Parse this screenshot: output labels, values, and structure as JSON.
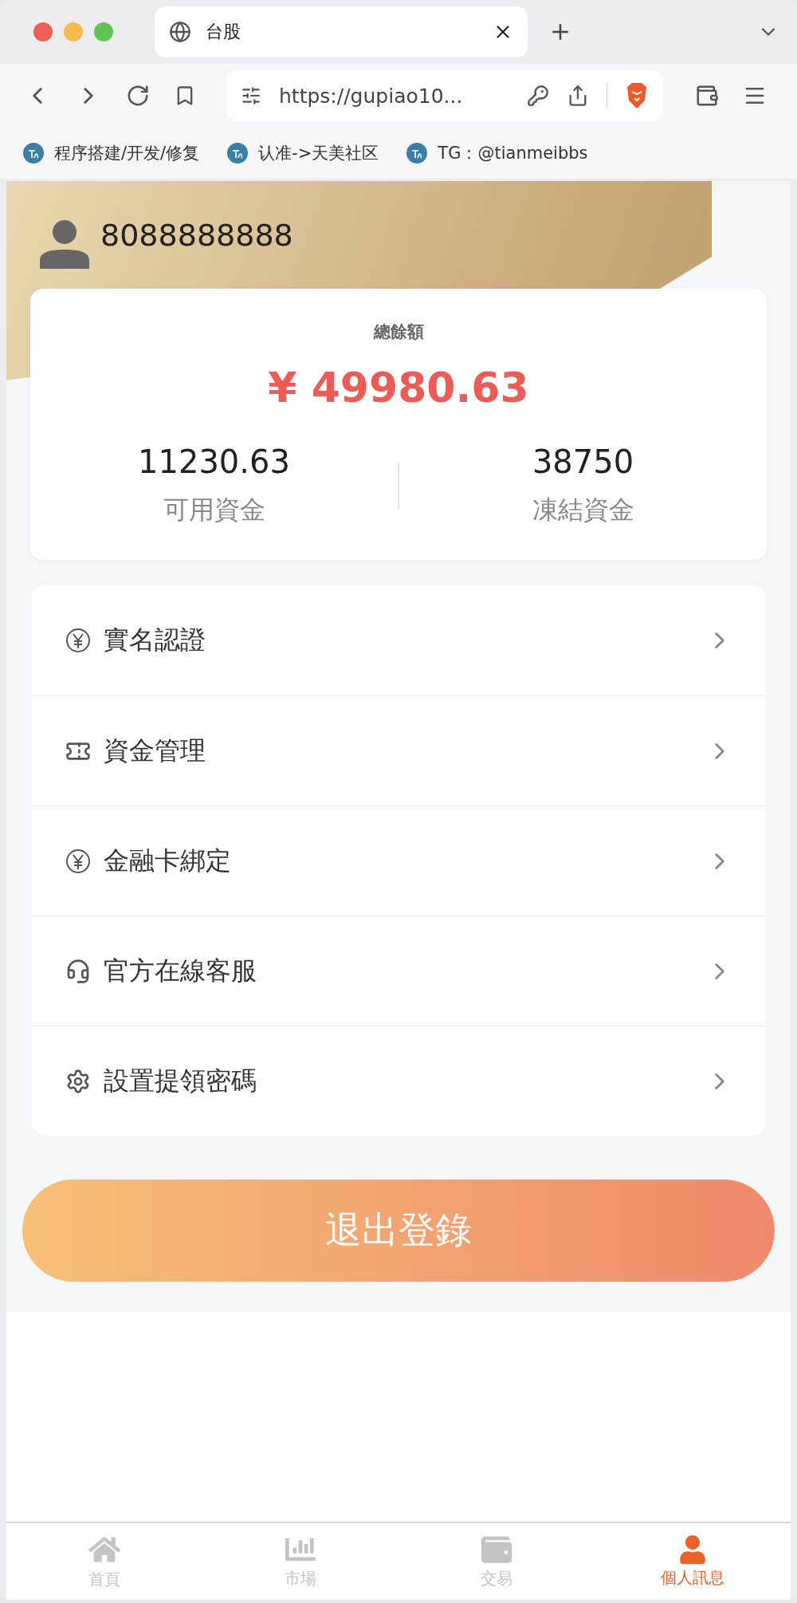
{
  "browser": {
    "tab": {
      "title": "台股"
    },
    "url": "https://gupiao10...",
    "bookmarks": [
      {
        "label": "程序搭建/开发/修复"
      },
      {
        "label": "认准->天美社区"
      },
      {
        "label": "TG：@tianmeibbs"
      }
    ]
  },
  "profile": {
    "username": "8088888888"
  },
  "balance": {
    "label": "總餘額",
    "total": "¥ 49980.63",
    "stats": [
      {
        "value": "11230.63",
        "label": "可用資金"
      },
      {
        "value": "38750",
        "label": "凍結資金"
      }
    ]
  },
  "menu": [
    {
      "kind": "yen",
      "label": "實名認證"
    },
    {
      "kind": "ticket",
      "label": "資金管理"
    },
    {
      "kind": "yen",
      "label": "金融卡綁定"
    },
    {
      "kind": "headset",
      "label": "官方在線客服"
    },
    {
      "kind": "gear",
      "label": "設置提領密碼"
    }
  ],
  "logout": "退出登錄",
  "nav": [
    {
      "kind": "home",
      "label": "首頁",
      "selected": false
    },
    {
      "kind": "chart",
      "label": "市場",
      "selected": false
    },
    {
      "kind": "wallet",
      "label": "交易",
      "selected": false
    },
    {
      "kind": "user",
      "label": "個人訊息",
      "selected": true
    }
  ]
}
